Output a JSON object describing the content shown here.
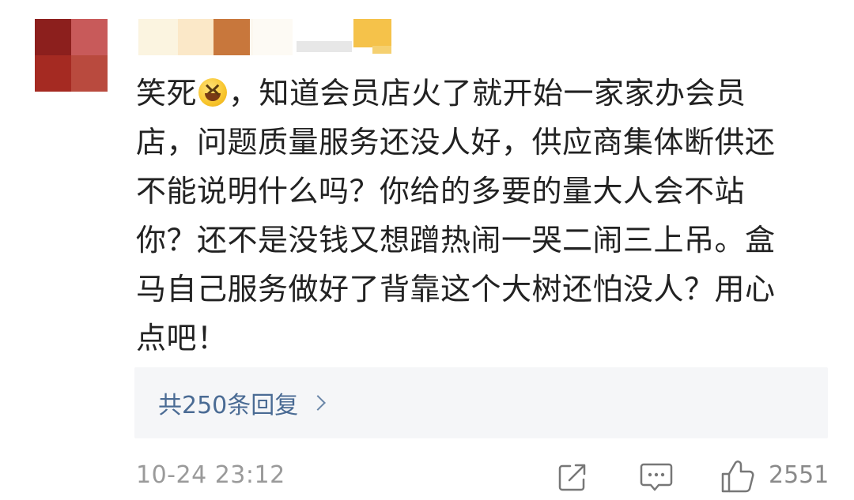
{
  "comment": {
    "lines": [
      {
        "before_emoji": "笑死",
        "emoji": "laughing-squint-emoji",
        "after_emoji": "，知道会员店火了就开始一家家办会员"
      },
      {
        "text": "店，问题质量服务还没人好，供应商集体断供还"
      },
      {
        "text": "不能说明什么吗？你给的多要的量大人会不站"
      },
      {
        "text": "你？还不是没钱又想蹭热闹一哭二闹三上吊。盒"
      },
      {
        "text": "马自己服务做好了背靠这个大树还怕没人？用心"
      },
      {
        "text": "点吧！"
      }
    ]
  },
  "replies": {
    "label": "共250条回复",
    "icon": "chevron-right-icon"
  },
  "footer": {
    "timestamp": "10-24 23:12",
    "share_icon": "share-icon",
    "comment_icon": "comment-icon",
    "like_icon": "thumbs-up-icon",
    "like_count": "2551"
  },
  "colors": {
    "text": "#222222",
    "link": "#4a6b94",
    "muted": "#9a9a9a",
    "panel": "#f5f6f8"
  }
}
